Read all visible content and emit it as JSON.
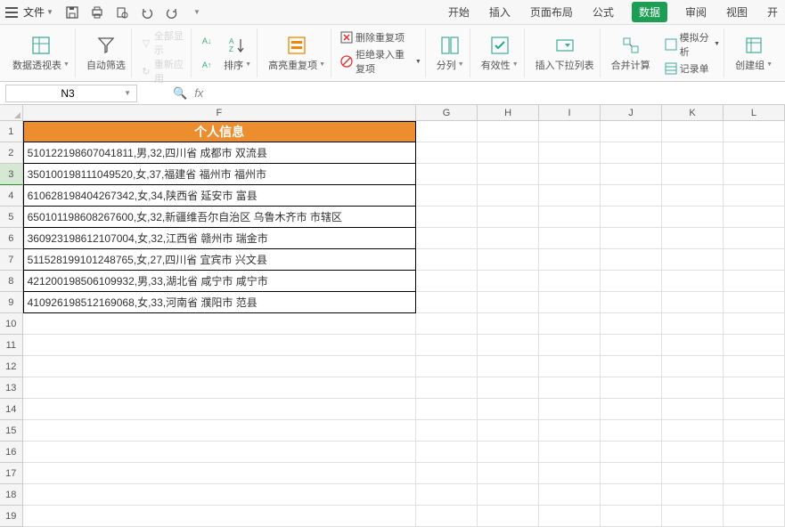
{
  "menubar": {
    "file": "文件",
    "tabs": [
      "开始",
      "插入",
      "页面布局",
      "公式",
      "数据",
      "审阅",
      "视图",
      "开"
    ],
    "activeTab": "数据"
  },
  "ribbon": {
    "pivot": "数据透视表",
    "autofilter": "自动筛选",
    "showall": "全部显示",
    "reapply": "重新应用",
    "sort_az": "A→Z",
    "sort_za": "Z→A",
    "sort": "排序",
    "highlight_dup": "高亮重复项",
    "remove_dup": "删除重复项",
    "reject_dup": "拒绝录入重复项",
    "text_to_col": "分列",
    "validation": "有效性",
    "insert_dropdown": "插入下拉列表",
    "consolidate": "合并计算",
    "whatif": "模拟分析",
    "form": "记录单",
    "group": "创建组"
  },
  "namebox": "N3",
  "columns": [
    "F",
    "G",
    "H",
    "I",
    "J",
    "K",
    "L"
  ],
  "header_label": "个人信息",
  "data_rows": [
    "510122198607041811,男,32,四川省  成都市  双流县",
    "350100198111049520,女,37,福建省  福州市  福州市",
    "610628198404267342,女,34,陕西省  延安市  富县",
    "650101198608267600,女,32,新疆维吾尔自治区  乌鲁木齐市  市辖区",
    "360923198612107004,女,32,江西省  赣州市  瑞金市",
    "511528199101248765,女,27,四川省  宜宾市  兴文县",
    "421200198506109932,男,33,湖北省  咸宁市  咸宁市",
    "410926198512169068,女,33,河南省  濮阳市  范县"
  ],
  "row_count": 19,
  "selected_row": 3
}
